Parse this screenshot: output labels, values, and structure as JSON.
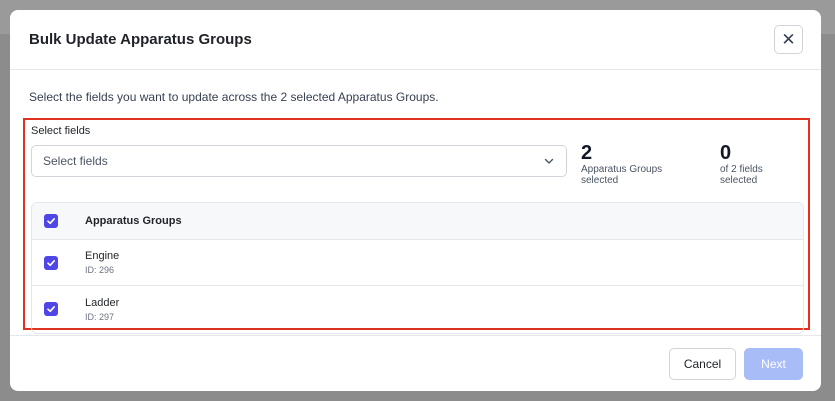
{
  "modal": {
    "title": "Bulk Update Apparatus Groups",
    "close_glyph": "✕",
    "intro": "Select the fields you want to update across the 2 selected Apparatus Groups.",
    "select": {
      "label": "Select fields",
      "placeholder": "Select fields"
    },
    "stats": [
      {
        "value": "2",
        "label": "Apparatus Groups selected"
      },
      {
        "value": "0",
        "label": "of 2 fields selected"
      }
    ],
    "table": {
      "header": "Apparatus Groups",
      "header_checked": true,
      "rows": [
        {
          "name": "Engine",
          "id": "ID: 296",
          "checked": true
        },
        {
          "name": "Ladder",
          "id": "ID: 297",
          "checked": true
        }
      ]
    },
    "footer": {
      "cancel_label": "Cancel",
      "next_label": "Next",
      "next_enabled": false
    }
  },
  "colors": {
    "accent": "#5046e5",
    "highlight_border": "#e0331f",
    "next_disabled": "#a8bcf7"
  }
}
